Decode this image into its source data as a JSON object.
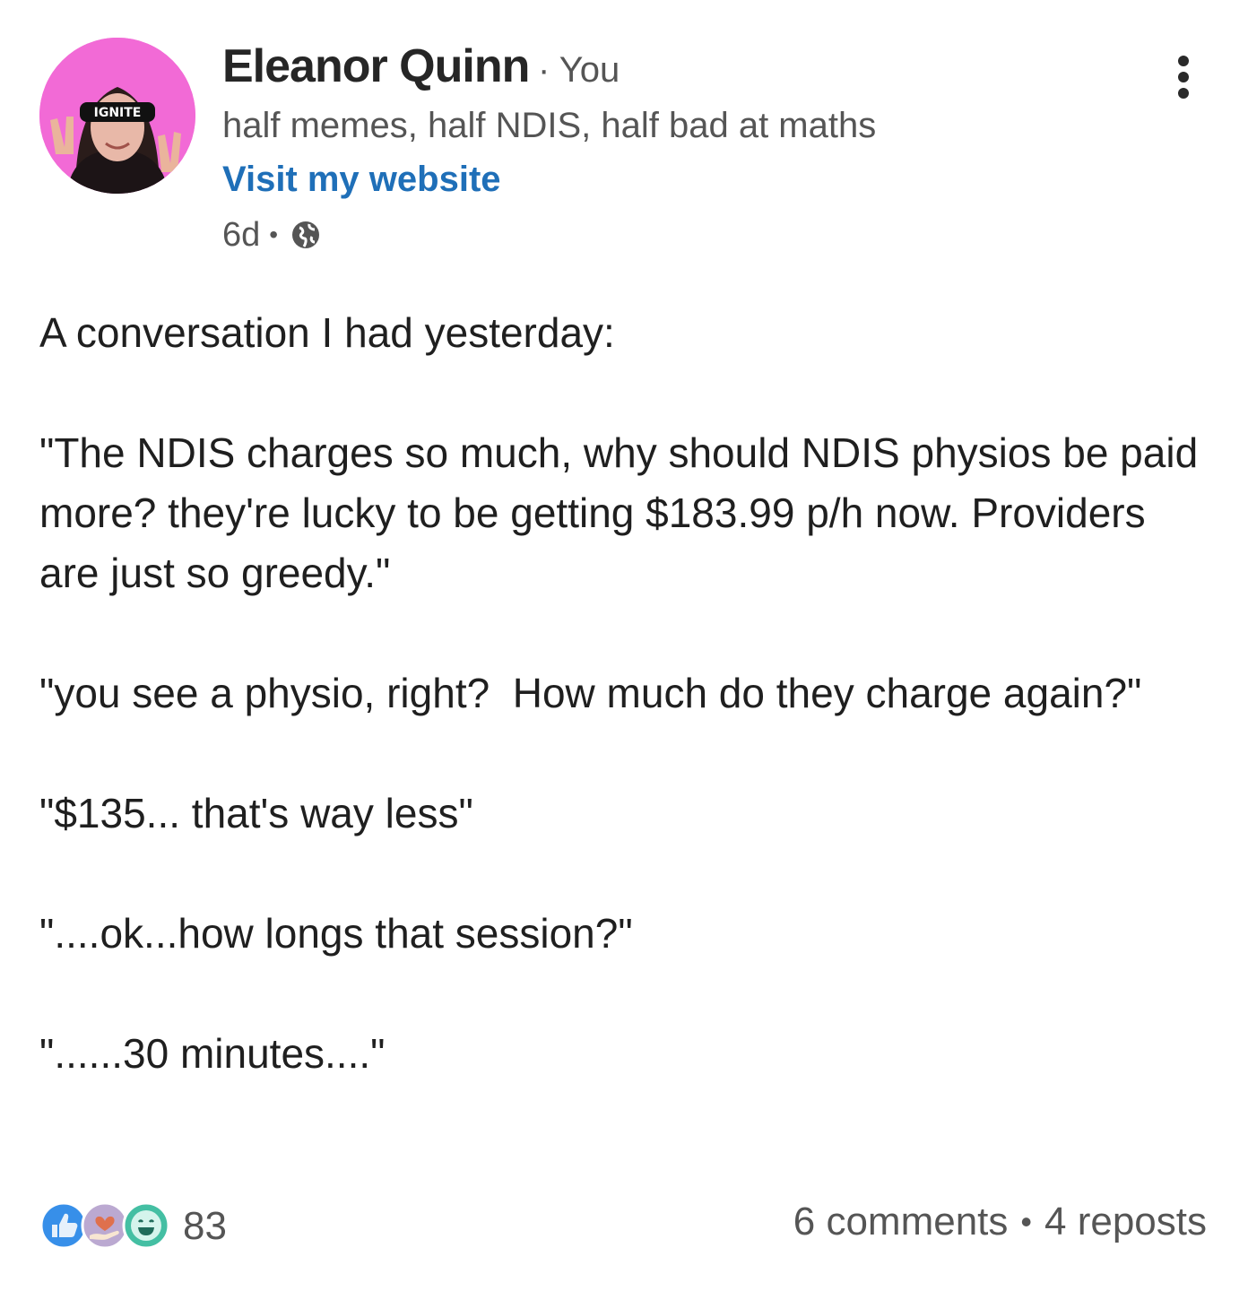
{
  "author": {
    "name": "Eleanor Quinn",
    "relation": "You",
    "headline": "half memes, half NDIS, half bad at maths",
    "website_label": "Visit my website",
    "post_age": "6d",
    "avatar_sunglasses_text": "IGNITE"
  },
  "post": {
    "paragraphs": [
      "A conversation I had yesterday:",
      "\"The NDIS charges so much, why should NDIS physios be paid more? they're lucky to be getting $183.99 p/h now. Providers are just so greedy.\"",
      "\"you see a physio, right?  How much do they charge again?\"",
      "\"$135... that's way less\"",
      "\"....ok...how longs that session?\"",
      "\"......30 minutes....\""
    ]
  },
  "footer": {
    "reaction_count": "83",
    "comments": "6 comments",
    "reposts": "4 reposts"
  },
  "icons": {
    "more": "more-vertical-icon",
    "visibility": "globe-icon",
    "reactions": [
      "like-icon",
      "support-icon",
      "funny-icon"
    ]
  },
  "colors": {
    "link": "#1f6fb8",
    "secondary_text": "#555555",
    "primary_text": "#1f1f1f",
    "avatar_bg": "#f26ad6"
  }
}
